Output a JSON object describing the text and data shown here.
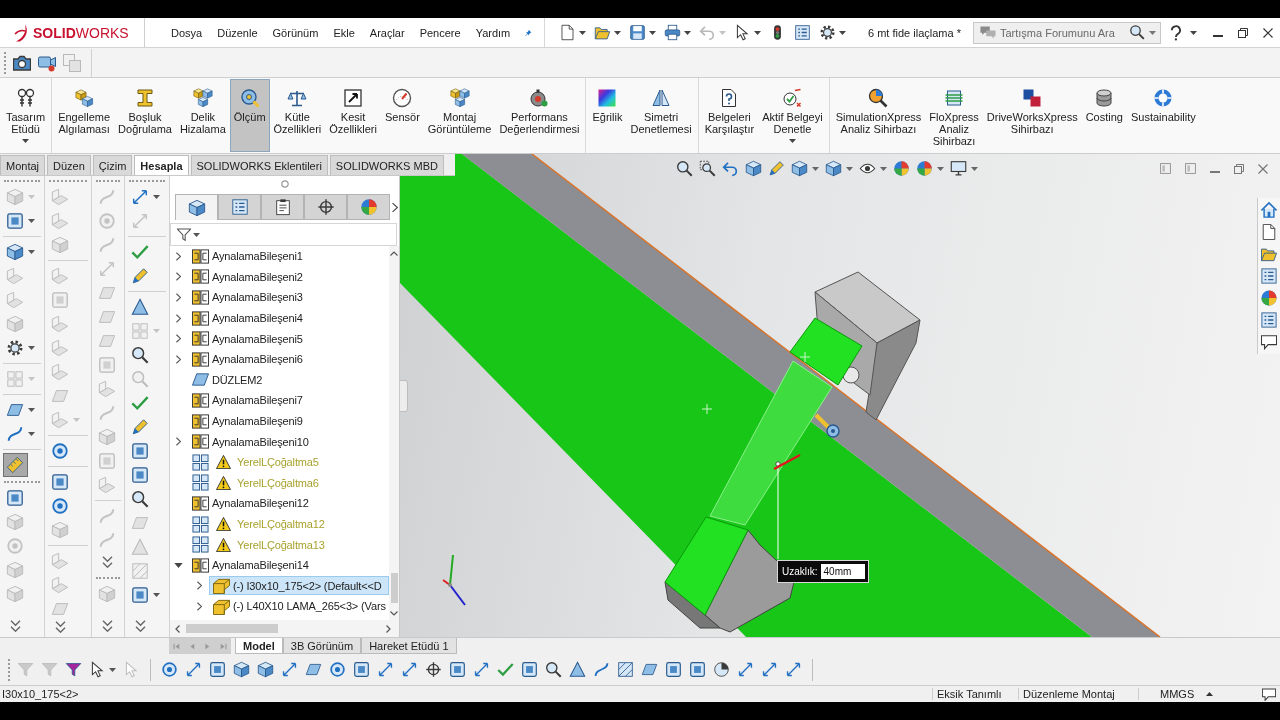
{
  "title_bar": {
    "logo": "**SOLID**WORKS",
    "menus": [
      "Dosya",
      "Düzenle",
      "Görünüm",
      "Ekle",
      "Araçlar",
      "Pencere",
      "Yardım"
    ],
    "quick_access": [
      {
        "kind": "dropdown",
        "disabled": false
      },
      {
        "kind": "dropdown",
        "disabled": false
      },
      {
        "kind": "dropdown",
        "disabled": false
      },
      {
        "kind": "dropdown",
        "disabled": false
      },
      {
        "kind": "dropdown",
        "disabled": true
      },
      {
        "kind": "dropdown",
        "disabled": false
      },
      {
        "kind": "tool",
        "disabled": false
      },
      {
        "kind": "tool",
        "disabled": false
      },
      {
        "kind": "dropdown",
        "disabled": false
      }
    ],
    "document_title": "6 mt fide ilaçlama *",
    "search": {
      "placeholder": "Tartışma Forumunu Ara"
    }
  },
  "capture_toolbar": [
    {
      "disabled": false
    },
    {
      "disabled": false
    },
    {
      "disabled": true
    }
  ],
  "ribbon": {
    "groups": [
      {
        "buttons": [
          {
            "label": "Tasarım\nEtüdü",
            "selected": false,
            "dropdown": true
          }
        ]
      },
      {
        "buttons": [
          {
            "label": "Engelleme\nAlgılaması",
            "selected": false,
            "dropdown": false
          },
          {
            "label": "Boşluk\nDoğrulama",
            "selected": false,
            "dropdown": false
          },
          {
            "label": "Delik\nHizalama",
            "selected": false,
            "dropdown": false
          },
          {
            "label": "Ölçüm",
            "selected": true,
            "dropdown": false
          },
          {
            "label": "Kütle\nÖzellikleri",
            "selected": false,
            "dropdown": false
          },
          {
            "label": "Kesit\nÖzellikleri",
            "selected": false,
            "dropdown": false
          },
          {
            "label": "Sensör",
            "selected": false,
            "dropdown": false
          },
          {
            "label": "Montaj\nGörüntüleme",
            "selected": false,
            "dropdown": false
          },
          {
            "label": "Performans\nDeğerlendirmesi",
            "selected": false,
            "dropdown": false
          }
        ]
      },
      {
        "buttons": [
          {
            "label": "Eğrilik",
            "selected": false,
            "dropdown": false
          },
          {
            "label": "Simetri\nDenetlemesi",
            "selected": false,
            "dropdown": false
          }
        ]
      },
      {
        "buttons": [
          {
            "label": "Belgeleri\nKarşılaştır",
            "selected": false,
            "dropdown": false
          },
          {
            "label": "Aktif Belgeyi\nDenetle",
            "selected": false,
            "dropdown": true
          }
        ]
      },
      {
        "buttons": [
          {
            "label": "SimulationXpress\nAnaliz Sihirbazı",
            "selected": false,
            "dropdown": false
          },
          {
            "label": "FloXpress\nAnaliz\nSihirbazı",
            "selected": false,
            "dropdown": false
          },
          {
            "label": "DriveWorksXpress\nSihirbazı",
            "selected": false,
            "dropdown": false
          },
          {
            "label": "Costing",
            "selected": false,
            "dropdown": false
          },
          {
            "label": "Sustainability",
            "selected": false,
            "dropdown": false
          }
        ]
      }
    ]
  },
  "command_tabs": [
    {
      "label": "Montaj",
      "selected": false
    },
    {
      "label": "Düzen",
      "selected": false
    },
    {
      "label": "Çizim",
      "selected": false
    },
    {
      "label": "Hesapla",
      "selected": true
    },
    {
      "label": "SOLIDWORKS Eklentileri",
      "selected": false
    },
    {
      "label": "SOLIDWORKS MBD",
      "selected": false
    }
  ],
  "left_toolbar_columns": [
    {
      "toolbars": [
        {
          "items": [
            {
              "kind": "dropdown",
              "disabled": true,
              "on": false
            },
            {
              "kind": "dropdown",
              "disabled": false,
              "on": false
            },
            {
              "kind": "separator"
            },
            {
              "kind": "dropdown",
              "disabled": false,
              "on": false
            },
            {
              "kind": "tool",
              "disabled": true,
              "on": false
            },
            {
              "kind": "tool",
              "disabled": true,
              "on": false
            },
            {
              "kind": "tool",
              "disabled": true,
              "on": false
            },
            {
              "kind": "dropdown",
              "disabled": false,
              "on": false
            },
            {
              "kind": "separator"
            },
            {
              "kind": "dropdown",
              "disabled": true,
              "on": false
            },
            {
              "kind": "separator"
            },
            {
              "kind": "dropdown",
              "disabled": false,
              "on": false
            },
            {
              "kind": "dropdown",
              "disabled": false,
              "on": false
            },
            {
              "kind": "separator"
            },
            {
              "kind": "tool",
              "disabled": false,
              "on": true
            }
          ]
        },
        {
          "items": [
            {
              "kind": "tool",
              "disabled": false,
              "on": false
            },
            {
              "kind": "tool",
              "disabled": true,
              "on": false
            },
            {
              "kind": "tool",
              "disabled": true,
              "on": false
            },
            {
              "kind": "tool",
              "disabled": true,
              "on": false
            },
            {
              "kind": "tool",
              "disabled": true,
              "on": false
            },
            {
              "kind": "more"
            }
          ]
        }
      ]
    },
    {
      "toolbars": [
        {
          "items": [
            {
              "kind": "tool",
              "disabled": true,
              "on": false
            },
            {
              "kind": "tool",
              "disabled": true,
              "on": false
            },
            {
              "kind": "tool",
              "disabled": true,
              "on": false
            },
            {
              "kind": "separator"
            },
            {
              "kind": "tool",
              "disabled": true,
              "on": false
            },
            {
              "kind": "tool",
              "disabled": true,
              "on": false
            },
            {
              "kind": "tool",
              "disabled": true,
              "on": false
            },
            {
              "kind": "tool",
              "disabled": true,
              "on": false
            },
            {
              "kind": "tool",
              "disabled": true,
              "on": false
            },
            {
              "kind": "tool",
              "disabled": true,
              "on": false
            },
            {
              "kind": "dropdown",
              "disabled": true,
              "on": false
            },
            {
              "kind": "separator"
            },
            {
              "kind": "tool",
              "disabled": false,
              "on": false
            },
            {
              "kind": "separator"
            },
            {
              "kind": "tool",
              "disabled": false,
              "on": false
            },
            {
              "kind": "tool",
              "disabled": false,
              "on": false
            },
            {
              "kind": "tool",
              "disabled": true,
              "on": false
            },
            {
              "kind": "separator"
            },
            {
              "kind": "tool",
              "disabled": true,
              "on": false
            },
            {
              "kind": "tool",
              "disabled": true,
              "on": false
            },
            {
              "kind": "tool",
              "disabled": true,
              "on": false
            },
            {
              "kind": "more"
            }
          ]
        }
      ]
    },
    {
      "toolbars": [
        {
          "items": [
            {
              "kind": "tool",
              "disabled": true,
              "on": false
            },
            {
              "kind": "tool",
              "disabled": true,
              "on": false
            },
            {
              "kind": "tool",
              "disabled": true,
              "on": false
            },
            {
              "kind": "tool",
              "disabled": true,
              "on": false
            },
            {
              "kind": "tool",
              "disabled": true,
              "on": false
            },
            {
              "kind": "tool",
              "disabled": true,
              "on": false
            },
            {
              "kind": "tool",
              "disabled": true,
              "on": false
            },
            {
              "kind": "tool",
              "disabled": true,
              "on": false
            },
            {
              "kind": "tool",
              "disabled": true,
              "on": false
            },
            {
              "kind": "tool",
              "disabled": true,
              "on": false
            },
            {
              "kind": "tool",
              "disabled": true,
              "on": false
            },
            {
              "kind": "tool",
              "disabled": true,
              "on": false
            },
            {
              "kind": "tool",
              "disabled": true,
              "on": false
            },
            {
              "kind": "separator"
            },
            {
              "kind": "tool",
              "disabled": true,
              "on": false
            },
            {
              "kind": "tool",
              "disabled": true,
              "on": false
            },
            {
              "kind": "more"
            }
          ]
        },
        {
          "items": [
            {
              "kind": "tool",
              "disabled": true,
              "on": false
            },
            {
              "kind": "more"
            }
          ]
        }
      ]
    },
    {
      "toolbars": [
        {
          "items": [
            {
              "kind": "dropdown",
              "disabled": false,
              "on": false
            },
            {
              "kind": "tool",
              "disabled": true,
              "on": false
            },
            {
              "kind": "separator"
            },
            {
              "kind": "tool",
              "disabled": false,
              "on": false
            },
            {
              "kind": "tool",
              "disabled": false,
              "on": false
            },
            {
              "kind": "separator"
            },
            {
              "kind": "tool",
              "disabled": false,
              "on": false
            },
            {
              "kind": "dropdown",
              "disabled": true,
              "on": false
            },
            {
              "kind": "tool",
              "disabled": false,
              "on": false
            },
            {
              "kind": "tool",
              "disabled": true,
              "on": false
            },
            {
              "kind": "tool",
              "disabled": false,
              "on": false
            },
            {
              "kind": "tool",
              "disabled": false,
              "on": false
            },
            {
              "kind": "tool",
              "disabled": false,
              "on": false
            },
            {
              "kind": "tool",
              "disabled": false,
              "on": false
            },
            {
              "kind": "tool",
              "disabled": false,
              "on": false
            },
            {
              "kind": "tool",
              "disabled": true,
              "on": false
            },
            {
              "kind": "tool",
              "disabled": true,
              "on": false
            },
            {
              "kind": "tool",
              "disabled": true,
              "on": false
            },
            {
              "kind": "dropdown",
              "disabled": false,
              "on": false
            },
            {
              "kind": "more"
            }
          ]
        }
      ]
    }
  ],
  "feature_tree": {
    "panel_tabs": [
      {
        "selected": true
      },
      {
        "selected": false
      },
      {
        "selected": false
      },
      {
        "selected": false
      },
      {
        "selected": false
      }
    ],
    "items": [
      {
        "label": "AynalamaBileşeni1",
        "kind": "mirror",
        "expandable": true,
        "expanded": false,
        "warning": false,
        "selected": false
      },
      {
        "label": "AynalamaBileşeni2",
        "kind": "mirror",
        "expandable": true,
        "expanded": false,
        "warning": false,
        "selected": false
      },
      {
        "label": "AynalamaBileşeni3",
        "kind": "mirror",
        "expandable": true,
        "expanded": false,
        "warning": false,
        "selected": false
      },
      {
        "label": "AynalamaBileşeni4",
        "kind": "mirror",
        "expandable": true,
        "expanded": false,
        "warning": false,
        "selected": false
      },
      {
        "label": "AynalamaBileşeni5",
        "kind": "mirror",
        "expandable": true,
        "expanded": false,
        "warning": false,
        "selected": false
      },
      {
        "label": "AynalamaBileşeni6",
        "kind": "mirror",
        "expandable": true,
        "expanded": false,
        "warning": false,
        "selected": false
      },
      {
        "label": "DÜZLEM2",
        "kind": "plane",
        "expandable": false,
        "expanded": false,
        "warning": false,
        "selected": false
      },
      {
        "label": "AynalamaBileşeni7",
        "kind": "mirror",
        "expandable": false,
        "expanded": false,
        "warning": false,
        "selected": false
      },
      {
        "label": "AynalamaBileşeni9",
        "kind": "mirror",
        "expandable": false,
        "expanded": false,
        "warning": false,
        "selected": false
      },
      {
        "label": "AynalamaBileşeni10",
        "kind": "mirror",
        "expandable": true,
        "expanded": false,
        "warning": false,
        "selected": false
      },
      {
        "label": "YerelLÇoğaltma5",
        "kind": "pattern",
        "expandable": false,
        "expanded": false,
        "warning": true,
        "selected": false
      },
      {
        "label": "YerelLÇoğaltma6",
        "kind": "pattern",
        "expandable": false,
        "expanded": false,
        "warning": true,
        "selected": false
      },
      {
        "label": "AynalamaBileşeni12",
        "kind": "mirror",
        "expandable": false,
        "expanded": false,
        "warning": false,
        "selected": false
      },
      {
        "label": "YerelLÇoğaltma12",
        "kind": "pattern",
        "expandable": false,
        "expanded": false,
        "warning": true,
        "selected": false
      },
      {
        "label": "YerelLÇoğaltma13",
        "kind": "pattern",
        "expandable": false,
        "expanded": false,
        "warning": true,
        "selected": false
      },
      {
        "label": "AynalamaBileşeni14",
        "kind": "mirror",
        "expandable": true,
        "expanded": true,
        "warning": false,
        "selected": false,
        "children": [
          {
            "label": "(-) I30x10_175<2> (Default<<D",
            "kind": "part",
            "expandable": true,
            "expanded": false,
            "warning": false,
            "selected": true
          },
          {
            "label": "(-) L40X10 LAMA_265<3> (Vars",
            "kind": "part",
            "expandable": true,
            "expanded": false,
            "warning": false,
            "selected": false
          }
        ]
      }
    ]
  },
  "viewport": {
    "measurement": {
      "label": "Uzaklık:",
      "value": "40mm"
    }
  },
  "bottom_tabs": [
    {
      "label": "Model",
      "selected": true
    },
    {
      "label": "3B Görünüm",
      "selected": false
    },
    {
      "label": "Hareket Etüdü 1",
      "selected": false
    }
  ],
  "selection_filter": [
    {
      "kind": "tool",
      "disabled": true
    },
    {
      "kind": "tool",
      "disabled": true
    },
    {
      "kind": "tool",
      "disabled": false
    },
    {
      "kind": "dropdown",
      "disabled": false
    },
    {
      "kind": "tool",
      "disabled": true
    },
    {
      "kind": "separator"
    },
    {
      "kind": "tool",
      "disabled": false
    },
    {
      "kind": "tool",
      "disabled": false
    },
    {
      "kind": "tool",
      "disabled": false
    },
    {
      "kind": "tool",
      "disabled": false
    },
    {
      "kind": "tool",
      "disabled": false
    },
    {
      "kind": "tool",
      "disabled": false
    },
    {
      "kind": "tool",
      "disabled": false
    },
    {
      "kind": "tool",
      "disabled": false
    },
    {
      "kind": "tool",
      "disabled": false
    },
    {
      "kind": "tool",
      "disabled": false
    },
    {
      "kind": "tool",
      "disabled": false
    },
    {
      "kind": "tool",
      "disabled": false
    },
    {
      "kind": "tool",
      "disabled": false
    },
    {
      "kind": "tool",
      "disabled": false
    },
    {
      "kind": "tool",
      "disabled": false
    },
    {
      "kind": "tool",
      "disabled": false
    },
    {
      "kind": "tool",
      "disabled": false
    },
    {
      "kind": "tool",
      "disabled": false
    },
    {
      "kind": "tool",
      "disabled": false
    },
    {
      "kind": "tool",
      "disabled": false
    },
    {
      "kind": "tool",
      "disabled": false
    },
    {
      "kind": "tool",
      "disabled": false
    },
    {
      "kind": "tool",
      "disabled": false
    },
    {
      "kind": "tool",
      "disabled": false
    },
    {
      "kind": "tool",
      "disabled": false
    },
    {
      "kind": "tool",
      "disabled": false
    },
    {
      "kind": "tool",
      "disabled": false
    },
    {
      "kind": "separator"
    }
  ],
  "status_bar": {
    "selection": "I30x10_175<2>",
    "items": [
      "Eksik Tanımlı",
      "Düzenleme Montaj"
    ],
    "units": "MMGS"
  }
}
